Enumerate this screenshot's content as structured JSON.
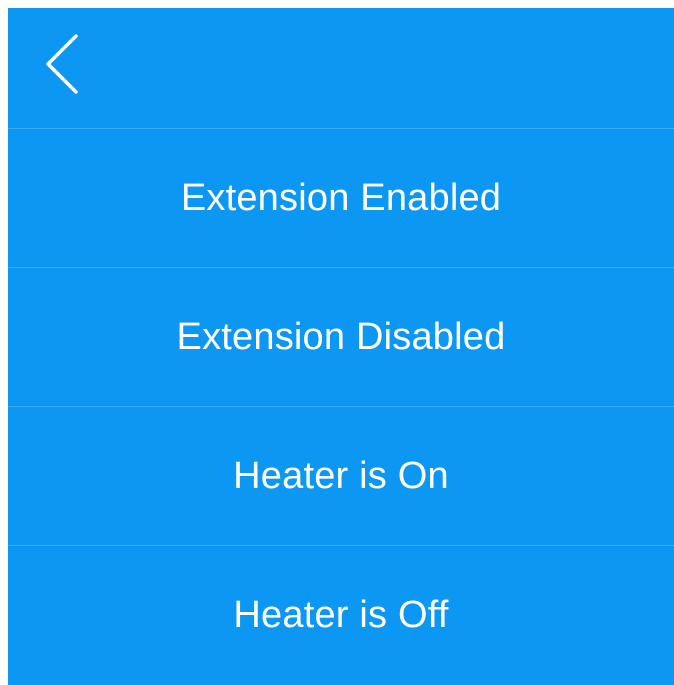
{
  "header": {
    "back_icon": "chevron-left-icon"
  },
  "menu": {
    "items": [
      {
        "label": "Extension Enabled"
      },
      {
        "label": "Extension Disabled"
      },
      {
        "label": "Heater is On"
      },
      {
        "label": "Heater is Off"
      }
    ]
  },
  "colors": {
    "background": "#0c97f2",
    "divider": "#3aabf3",
    "text": "#ffffff"
  }
}
